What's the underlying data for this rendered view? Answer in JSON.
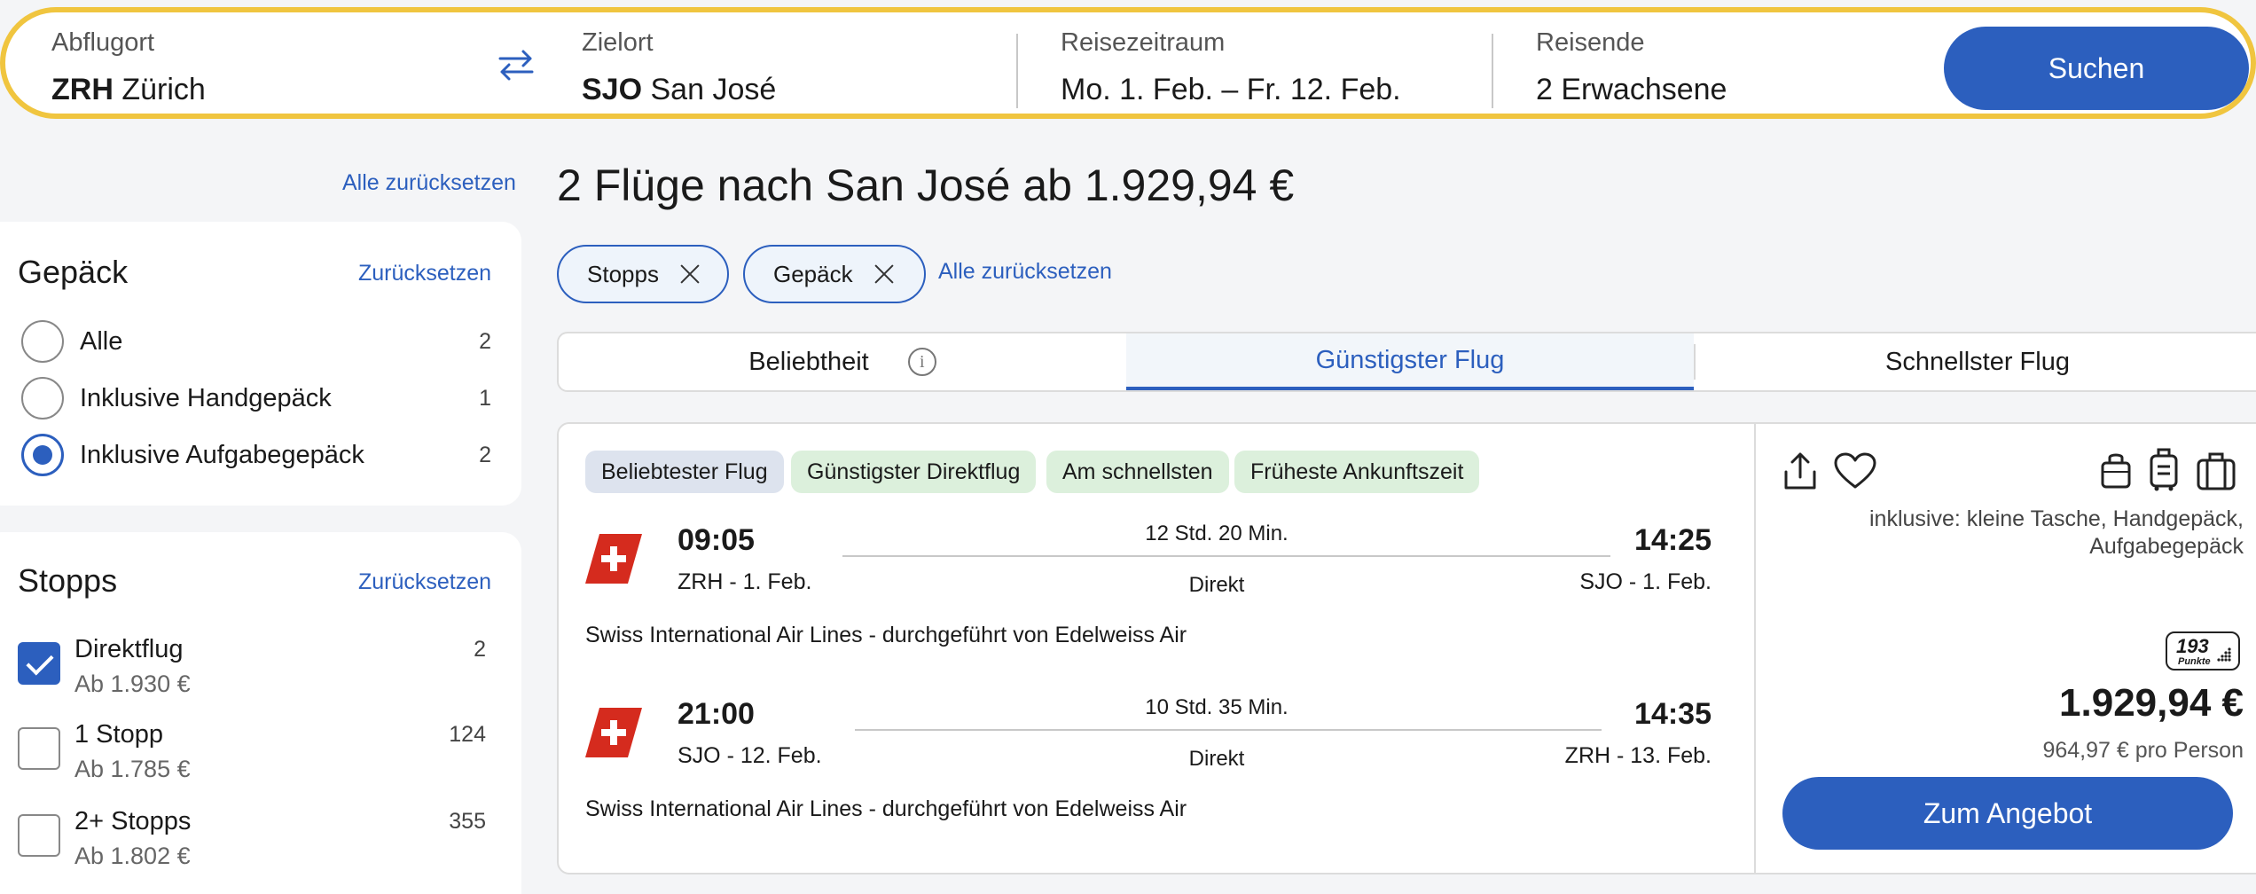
{
  "search": {
    "from_label": "Abflugort",
    "from_code": "ZRH",
    "from_city": "Zürich",
    "to_label": "Zielort",
    "to_code": "SJO",
    "to_city": "San José",
    "date_label": "Reisezeitraum",
    "date_value": "Mo. 1. Feb. – Fr. 12. Feb.",
    "pax_label": "Reisende",
    "pax_value": "2 Erwachsene",
    "search_button": "Suchen",
    "swap_icon": "swap-arrows-icon"
  },
  "sidebar": {
    "reset_all": "Alle zurücksetzen",
    "baggage": {
      "title": "Gepäck",
      "reset": "Zurücksetzen",
      "options": [
        {
          "label": "Alle",
          "count": "2",
          "selected": false
        },
        {
          "label": "Inklusive Handgepäck",
          "count": "1",
          "selected": false
        },
        {
          "label": "Inklusive Aufgabegepäck",
          "count": "2",
          "selected": true
        }
      ]
    },
    "stops": {
      "title": "Stopps",
      "reset": "Zurücksetzen",
      "options": [
        {
          "label": "Direktflug",
          "sub": "Ab 1.930 €",
          "count": "2",
          "checked": true
        },
        {
          "label": "1 Stopp",
          "sub": "Ab 1.785 €",
          "count": "124",
          "checked": false
        },
        {
          "label": "2+ Stopps",
          "sub": "Ab 1.802 €",
          "count": "355",
          "checked": false
        }
      ]
    }
  },
  "main": {
    "heading": "2 Flüge nach San José ab 1.929,94 €",
    "chips": [
      {
        "label": "Stopps"
      },
      {
        "label": "Gepäck"
      }
    ],
    "reset_all": "Alle zurücksetzen",
    "sort_tabs": [
      {
        "label": "Beliebtheit",
        "active": false
      },
      {
        "label": "Günstigster Flug",
        "active": true
      },
      {
        "label": "Schnellster Flug",
        "active": false
      }
    ],
    "info_glyph": "i"
  },
  "result": {
    "badges": [
      "Beliebtester Flug",
      "Günstigster Direktflug",
      "Am schnellsten",
      "Früheste Ankunftszeit"
    ],
    "legs": [
      {
        "dep_time": "09:05",
        "dep_place": "ZRH  -  1. Feb.",
        "duration": "12 Std. 20 Min.",
        "stops": "Direkt",
        "arr_time": "14:25",
        "arr_place": "SJO  -  1. Feb.",
        "airline": "Swiss International Air Lines - durchgeführt von Edelweiss Air"
      },
      {
        "dep_time": "21:00",
        "dep_place": "SJO  -  12. Feb.",
        "duration": "10 Std. 35 Min.",
        "stops": "Direkt",
        "arr_time": "14:35",
        "arr_place": "ZRH  -  13. Feb.",
        "airline": "Swiss International Air Lines - durchgeführt von Edelweiss Air"
      }
    ],
    "inclusive": "inklusive: kleine Tasche, Handgepäck, Aufgabegepäck",
    "points_number": "193",
    "points_label": "Punkte",
    "price": "1.929,94 €",
    "per_person": "964,97 € pro Person",
    "offer_button": "Zum Angebot",
    "icons": [
      "share-icon",
      "heart-icon",
      "small-bag-icon",
      "hand-luggage-icon",
      "checked-luggage-icon"
    ],
    "colors": {
      "brand_blue": "#2c5fbe",
      "swiss_red": "#d52b1e",
      "highlight_yellow": "#f0c53f",
      "badge_green": "#dcf0dc"
    }
  }
}
